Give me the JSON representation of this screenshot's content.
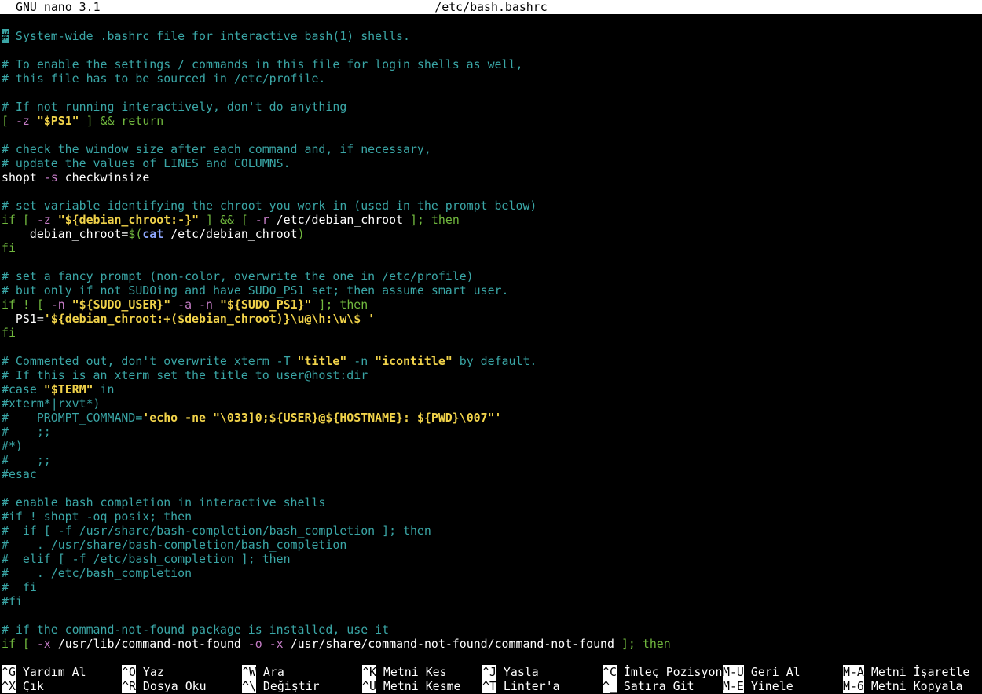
{
  "titlebar": {
    "app": "GNU nano 3.1",
    "file": "/etc/bash.bashrc"
  },
  "lines": [
    [
      {
        "t": "#",
        "c": "cursor"
      },
      {
        "t": " System-wide .bashrc file for interactive bash(1) shells.",
        "c": "c-comment"
      }
    ],
    [],
    [
      {
        "t": "# To enable the settings / commands in this file for login shells as well,",
        "c": "c-comment"
      }
    ],
    [
      {
        "t": "# this file has to be sourced in /etc/profile.",
        "c": "c-comment"
      }
    ],
    [],
    [
      {
        "t": "# If not running interactively, don't do anything",
        "c": "c-comment"
      }
    ],
    [
      {
        "t": "[ ",
        "c": "c-kw"
      },
      {
        "t": "-z",
        "c": "c-op"
      },
      {
        "t": " "
      },
      {
        "t": "\"$PS1\"",
        "c": "c-str"
      },
      {
        "t": " ] && return",
        "c": "c-kw"
      }
    ],
    [],
    [
      {
        "t": "# check the window size after each command and, if necessary,",
        "c": "c-comment"
      }
    ],
    [
      {
        "t": "# update the values of LINES and COLUMNS.",
        "c": "c-comment"
      }
    ],
    [
      {
        "t": "shopt "
      },
      {
        "t": "-s",
        "c": "c-op"
      },
      {
        "t": " checkwinsize"
      }
    ],
    [],
    [
      {
        "t": "# set variable identifying the chroot you work in (used in the prompt below)",
        "c": "c-comment"
      }
    ],
    [
      {
        "t": "if [ ",
        "c": "c-kw"
      },
      {
        "t": "-z",
        "c": "c-op"
      },
      {
        "t": " "
      },
      {
        "t": "\"${debian_chroot:-}\"",
        "c": "c-str"
      },
      {
        "t": " ] && [ ",
        "c": "c-kw"
      },
      {
        "t": "-r",
        "c": "c-op"
      },
      {
        "t": " /etc/debian_chroot "
      },
      {
        "t": "]; then",
        "c": "c-kw"
      }
    ],
    [
      {
        "t": "    debian_chroot="
      },
      {
        "t": "$(",
        "c": "c-kw"
      },
      {
        "t": "cat",
        "c": "c-cmd"
      },
      {
        "t": " /etc/debian_chroot"
      },
      {
        "t": ")",
        "c": "c-kw"
      }
    ],
    [
      {
        "t": "fi",
        "c": "c-kw"
      }
    ],
    [],
    [
      {
        "t": "# set a fancy prompt (non-color, overwrite the one in /etc/profile)",
        "c": "c-comment"
      }
    ],
    [
      {
        "t": "# but only if not SUDOing and have SUDO_PS1 set; then assume smart user.",
        "c": "c-comment"
      }
    ],
    [
      {
        "t": "if ! [ ",
        "c": "c-kw"
      },
      {
        "t": "-n",
        "c": "c-op"
      },
      {
        "t": " "
      },
      {
        "t": "\"${SUDO_USER}\"",
        "c": "c-str"
      },
      {
        "t": " "
      },
      {
        "t": "-a",
        "c": "c-op"
      },
      {
        "t": " "
      },
      {
        "t": "-n",
        "c": "c-op"
      },
      {
        "t": " "
      },
      {
        "t": "\"${SUDO_PS1}\"",
        "c": "c-str"
      },
      {
        "t": " ]; then",
        "c": "c-kw"
      }
    ],
    [
      {
        "t": "  PS1="
      },
      {
        "t": "'${debian_chroot:+($debian_chroot)}\\u@\\h:\\w\\$ '",
        "c": "c-str"
      }
    ],
    [
      {
        "t": "fi",
        "c": "c-kw"
      }
    ],
    [],
    [
      {
        "t": "# Commented out, don't overwrite xterm -T ",
        "c": "c-comment"
      },
      {
        "t": "\"title\"",
        "c": "c-str"
      },
      {
        "t": " -n ",
        "c": "c-comment"
      },
      {
        "t": "\"icontitle\"",
        "c": "c-str"
      },
      {
        "t": " by default.",
        "c": "c-comment"
      }
    ],
    [
      {
        "t": "# If this is an xterm set the title to user@host:dir",
        "c": "c-comment"
      }
    ],
    [
      {
        "t": "#case ",
        "c": "c-comment"
      },
      {
        "t": "\"$TERM\"",
        "c": "c-str"
      },
      {
        "t": " in",
        "c": "c-comment"
      }
    ],
    [
      {
        "t": "#xterm*|rxvt*)",
        "c": "c-comment"
      }
    ],
    [
      {
        "t": "#    PROMPT_COMMAND=",
        "c": "c-comment"
      },
      {
        "t": "'echo -ne \"\\033]0;${USER}@${HOSTNAME}: ${PWD}\\007\"'",
        "c": "c-str"
      }
    ],
    [
      {
        "t": "#    ;;",
        "c": "c-comment"
      }
    ],
    [
      {
        "t": "#*)",
        "c": "c-comment"
      }
    ],
    [
      {
        "t": "#    ;;",
        "c": "c-comment"
      }
    ],
    [
      {
        "t": "#esac",
        "c": "c-comment"
      }
    ],
    [],
    [
      {
        "t": "# enable bash completion in interactive shells",
        "c": "c-comment"
      }
    ],
    [
      {
        "t": "#if ! shopt -oq posix; then",
        "c": "c-comment"
      }
    ],
    [
      {
        "t": "#  if [ -f /usr/share/bash-completion/bash_completion ]; then",
        "c": "c-comment"
      }
    ],
    [
      {
        "t": "#    . /usr/share/bash-completion/bash_completion",
        "c": "c-comment"
      }
    ],
    [
      {
        "t": "#  elif [ -f /etc/bash_completion ]; then",
        "c": "c-comment"
      }
    ],
    [
      {
        "t": "#    . /etc/bash_completion",
        "c": "c-comment"
      }
    ],
    [
      {
        "t": "#  fi",
        "c": "c-comment"
      }
    ],
    [
      {
        "t": "#fi",
        "c": "c-comment"
      }
    ],
    [],
    [
      {
        "t": "# if the command-not-found package is installed, use it",
        "c": "c-comment"
      }
    ],
    [
      {
        "t": "if [ ",
        "c": "c-kw"
      },
      {
        "t": "-x",
        "c": "c-op"
      },
      {
        "t": " /usr/lib/command-not-found "
      },
      {
        "t": "-o",
        "c": "c-op"
      },
      {
        "t": " "
      },
      {
        "t": "-x",
        "c": "c-op"
      },
      {
        "t": " /usr/share/command-not-found/command-not-found "
      },
      {
        "t": "]; then",
        "c": "c-kw"
      }
    ]
  ],
  "shortcuts": [
    [
      {
        "key": "^G",
        "label": " Yardım Al"
      },
      {
        "key": "^O",
        "label": " Yaz"
      },
      {
        "key": "^W",
        "label": " Ara"
      },
      {
        "key": "^K",
        "label": " Metni Kes"
      },
      {
        "key": "^J",
        "label": " Yasla"
      },
      {
        "key": "^C",
        "label": " İmleç Pozisyonu"
      },
      {
        "key": "M-U",
        "label": " Geri Al"
      },
      {
        "key": "M-A",
        "label": " Metni İşaretle"
      }
    ],
    [
      {
        "key": "^X",
        "label": " Çık"
      },
      {
        "key": "^R",
        "label": " Dosya Oku"
      },
      {
        "key": "^\\",
        "label": " Değiştir"
      },
      {
        "key": "^U",
        "label": " Metni Kesme"
      },
      {
        "key": "^T",
        "label": " Linter'a"
      },
      {
        "key": "^_",
        "label": " Satıra Git"
      },
      {
        "key": "M-E",
        "label": " Yinele"
      },
      {
        "key": "M-6",
        "label": " Metni Kopyala"
      }
    ]
  ]
}
